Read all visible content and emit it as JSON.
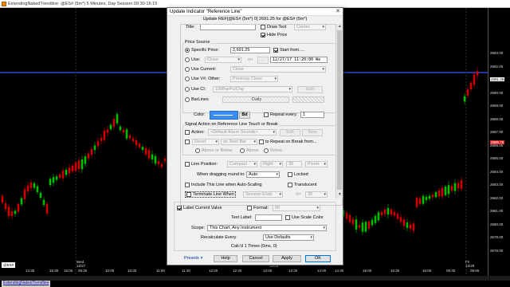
{
  "window": {
    "title": "ExtendingNakedTrendline: @ES# (5m*) 5 Minutes, Day Session 09:30-16:15"
  },
  "chart": {
    "colors": {
      "background": "#000000",
      "up": "#00c000",
      "down": "#d00000",
      "reference_line": "#2e5bff"
    },
    "price_labels": [
      "2693.00",
      "2692.00",
      "2691.25",
      "2690.00",
      "2689.00",
      "2688.00",
      "2687.00",
      "2686.00",
      "2685.00",
      "2684.00",
      "2683.00",
      "2682.00",
      "2681.00",
      "2680.00",
      "2679.00",
      "2678.00"
    ],
    "highlight_labels": [
      "2691.25",
      "2685.75"
    ],
    "time_labels": [
      "14:35",
      "15:30",
      "16:05",
      "09:30",
      "10:00",
      "10:30",
      "11:00",
      "11:30",
      "12:00",
      "12:30",
      "13:00",
      "13:30",
      "14:00",
      "14:30",
      "15:00",
      "15:30",
      "16:05",
      "09:30",
      "09:55"
    ],
    "day_labels": [
      {
        "day": "Wed",
        "date": "12/27"
      },
      {
        "day": "Thu",
        "date": "12/28"
      },
      {
        "day": "Fri",
        "date": "12/29"
      }
    ],
    "symbol_tag": "@ES#",
    "tab_label": "ExtendingNakedTrendline"
  },
  "dialog": {
    "title": "Update Indicator \"Reference Line\"",
    "subtitle": "Update REF[@ES# (5m*) 0] 2691.25 for @ES# (5m*)",
    "close": "✕",
    "top_rows": {
      "title_label": "Title:",
      "draw_text": "Draw Text",
      "center_value": "Center",
      "hide_price": "Hide Price"
    },
    "price_source": {
      "group": "Price Source",
      "specific_price": "Specific Price:",
      "specific_price_value": "2,691.25",
      "start_from": "Start from.....",
      "use": "Use:",
      "use_value": "Close",
      "on": "on",
      "datetime": "12/27/17 11:20:00 We",
      "use_current": "Use Current:",
      "use_current_value": "Close",
      "use_vwap": "Use V#, Other:",
      "use_vwap_value": "Previous Close",
      "use_ci": "Use CI:",
      "use_ci_value": "100BarPctChg",
      "edit": "Edit",
      "barlines": "BarLines",
      "barlines_value": "Daily"
    },
    "color": {
      "label": "Color:",
      "repeat_every": "Repeat every:",
      "repeat_value": "1"
    },
    "signal": {
      "group": "Signal Action on Reference Line Touch or Break",
      "action": "Action:",
      "action_value": "<Default Alarm Sounds>",
      "edit": "Edit",
      "new": "New",
      "reset": "Reset",
      "reset_value": "on Next Bar",
      "repeat_on_break": "to Repeat on Break from...",
      "above_or_below": "Above or Below",
      "above": "Above",
      "below": "Below"
    },
    "line_position": {
      "label": "Line Position:",
      "compact": "Compact",
      "right": "Right",
      "offset": "30",
      "pixels": "Pixels"
    },
    "dragging": {
      "label": "When dragging round to:",
      "value": "Auto",
      "locked": "Locked"
    },
    "autoscale": {
      "label": "Include This Line when Auto-Scaling",
      "translucent": "Translucent"
    },
    "terminate": {
      "label": "Terminate Line When",
      "value": "Session Ends",
      "x_label": "X=",
      "x_value": "30"
    },
    "label_current_value": "Label Current Value",
    "format": {
      "label": "Format:",
      "value": "99"
    },
    "text_label": "Text Label:",
    "use_scale_color": "Use Scale Color",
    "scope": {
      "label": "Scope:",
      "value": "This Chart, Any Instrument"
    },
    "recalculate": {
      "label": "Recalculate Every",
      "value": "Use Defaults"
    },
    "calcd": "Calc'd 1 Times (0ms, 0)",
    "buttons": {
      "presets": "Presets",
      "help": "Help",
      "cancel": "Cancel",
      "apply": "Apply",
      "ok": "OK"
    }
  }
}
